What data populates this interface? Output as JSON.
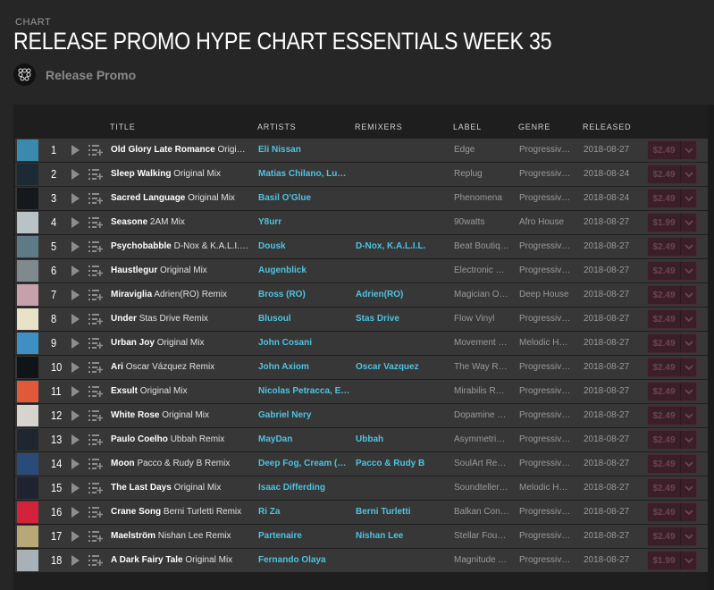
{
  "header": {
    "kicker": "CHART",
    "title": "RELEASE PROMO HYPE CHART ESSENTIALS WEEK 35",
    "curator": "Release Promo"
  },
  "columns": {
    "title": "TITLE",
    "artists": "ARTISTS",
    "remixers": "REMIXERS",
    "label": "LABEL",
    "genre": "GENRE",
    "released": "RELEASED"
  },
  "colors": {
    "background": "#262626",
    "row": "#373737",
    "link": "#4fc3e0",
    "buy_button": "#3a1f28"
  },
  "tracks": [
    {
      "num": "1",
      "name": "Old Glory Late Romance",
      "mix": "Original Mix",
      "artists": "Eli Nissan",
      "remixers": "",
      "label": "Edge",
      "genre": "Progressive House",
      "released": "2018-08-27",
      "price": "$2.49",
      "art": "#3a8ab0"
    },
    {
      "num": "2",
      "name": "Sleep Walking",
      "mix": "Original Mix",
      "artists": "Matias Chilano, Lukas Cosimo",
      "remixers": "",
      "label": "Replug",
      "genre": "Progressive House",
      "released": "2018-08-24",
      "price": "$2.49",
      "art": "#1c2a33"
    },
    {
      "num": "3",
      "name": "Sacred Language",
      "mix": "Original Mix",
      "artists": "Basil O'Glue",
      "remixers": "",
      "label": "Phenomena",
      "genre": "Progressive House",
      "released": "2018-08-24",
      "price": "$2.49",
      "art": "#15181c"
    },
    {
      "num": "4",
      "name": "Seasone",
      "mix": "2AM Mix",
      "artists": "Y8urr",
      "remixers": "",
      "label": "90watts",
      "genre": "Afro House",
      "released": "2018-08-27",
      "price": "$1.99",
      "art": "#b9c2c6"
    },
    {
      "num": "5",
      "name": "Psychobabble",
      "mix": "D-Nox & K.A.L.I.L. Remix",
      "artists": "Dousk",
      "remixers": "D-Nox, K.A.L.I.L.",
      "label": "Beat Boutique",
      "genre": "Progressive House",
      "released": "2018-08-27",
      "price": "$2.49",
      "art": "#5d7a86"
    },
    {
      "num": "6",
      "name": "Haustlegur",
      "mix": "Original Mix",
      "artists": "Augenblick",
      "remixers": "",
      "label": "Electronic Tree",
      "genre": "Progressive House",
      "released": "2018-08-27",
      "price": "$2.49",
      "art": "#7f8a8e"
    },
    {
      "num": "7",
      "name": "Miraviglia",
      "mix": "Adrien(RO) Remix",
      "artists": "Bross (RO)",
      "remixers": "Adrien(RO)",
      "label": "Magician On Duty",
      "genre": "Deep House",
      "released": "2018-08-27",
      "price": "$2.49",
      "art": "#c6a0aa"
    },
    {
      "num": "8",
      "name": "Under",
      "mix": "Stas Drive Remix",
      "artists": "Blusoul",
      "remixers": "Stas Drive",
      "label": "Flow Vinyl",
      "genre": "Progressive House",
      "released": "2018-08-27",
      "price": "$2.49",
      "art": "#e8e2c8"
    },
    {
      "num": "9",
      "name": "Urban Joy",
      "mix": "Original Mix",
      "artists": "John Cosani",
      "remixers": "",
      "label": "Movement Recordings",
      "genre": "Melodic House",
      "released": "2018-08-27",
      "price": "$2.49",
      "art": "#3d8fc4"
    },
    {
      "num": "10",
      "name": "Ari",
      "mix": "Oscar Vázquez Remix",
      "artists": "John Axiom",
      "remixers": "Oscar Vazquez",
      "label": "The Way Records",
      "genre": "Progressive House",
      "released": "2018-08-27",
      "price": "$2.49",
      "art": "#0f1418"
    },
    {
      "num": "11",
      "name": "Exsult",
      "mix": "Original Mix",
      "artists": "Nicolas Petracca, Emiliano",
      "remixers": "",
      "label": "Mirabilis Records",
      "genre": "Progressive House",
      "released": "2018-08-27",
      "price": "$2.49",
      "art": "#e2583a"
    },
    {
      "num": "12",
      "name": "White Rose",
      "mix": "Original Mix",
      "artists": "Gabriel Nery",
      "remixers": "",
      "label": "Dopamine Music",
      "genre": "Progressive House",
      "released": "2018-08-27",
      "price": "$2.49",
      "art": "#d7d3cf"
    },
    {
      "num": "13",
      "name": "Paulo Coelho",
      "mix": "Ubbah Remix",
      "artists": "MayDan",
      "remixers": "Ubbah",
      "label": "Asymmetric Recordings",
      "genre": "Progressive House",
      "released": "2018-08-27",
      "price": "$2.49",
      "art": "#1e2630"
    },
    {
      "num": "14",
      "name": "Moon",
      "mix": "Pacco & Rudy B Remix",
      "artists": "Deep Fog, Cream (PL)",
      "remixers": "Pacco & Rudy B",
      "label": "SoulArt Recordings",
      "genre": "Progressive House",
      "released": "2018-08-27",
      "price": "$2.49",
      "art": "#2a4a7a"
    },
    {
      "num": "15",
      "name": "The Last Days",
      "mix": "Original Mix",
      "artists": "Isaac Differding",
      "remixers": "",
      "label": "Soundteller Records",
      "genre": "Melodic House",
      "released": "2018-08-27",
      "price": "$2.49",
      "art": "#1f2230"
    },
    {
      "num": "16",
      "name": "Crane Song",
      "mix": "Berni Turletti Remix",
      "artists": "Ri Za",
      "remixers": "Berni Turletti",
      "label": "Balkan Connection",
      "genre": "Progressive House",
      "released": "2018-08-27",
      "price": "$2.49",
      "art": "#d2233a"
    },
    {
      "num": "17",
      "name": "Maelström",
      "mix": "Nishan Lee Remix",
      "artists": "Partenaire",
      "remixers": "Nishan Lee",
      "label": "Stellar Fountain",
      "genre": "Progressive House",
      "released": "2018-08-27",
      "price": "$2.49",
      "art": "#b8a878"
    },
    {
      "num": "18",
      "name": "A Dark Fairy Tale",
      "mix": "Original Mix",
      "artists": "Fernando Olaya",
      "remixers": "",
      "label": "Magnitude Audio",
      "genre": "Progressive House",
      "released": "2018-08-27",
      "price": "$1.99",
      "art": "#a8b0b8"
    }
  ]
}
